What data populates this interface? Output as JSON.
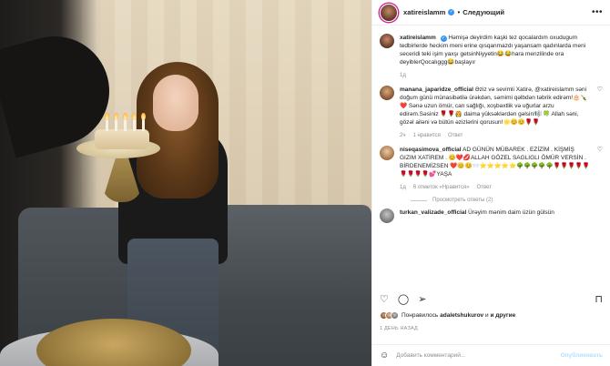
{
  "header": {
    "username": "xatireislamm",
    "separator": "•",
    "follow_label": "Следующий",
    "more_label": "•••"
  },
  "caption": {
    "username": "xatireislamm",
    "text": "Həmişə deyirdim kaşki tez qocalardım oxudugum tedbirlerde heckim meni erine qısqanmazdı yaşansam qadınlarda meni seceridi teki işim yaxşı getsinNiyyetin😂😂hara menzilinde ora deyiblerQocalıggg😂başlayır",
    "time": "1д"
  },
  "comments": [
    {
      "username": "manana_japaridze_official",
      "text": "Əziz və sevimli Xatirə, @xatireislamm səni doğum günü münasibətilə ürəkdən, səmimi qəlbdən təbrik edirəm!🎂🍾❤️ Sənə uzun ömür, can sağlığı, xoşbəxtlik və uğurlar arzu edirəm.Səsiniz 🌹🌹👸 daima yüksəklərdən gəlsin!🎼🍀 Allah səni, gözəl ailəni və bütün əzizlərini qorusun!🌟😊😊🌹🌹",
      "time": "2ч",
      "likes": "1 нравится",
      "reply": "Ответ"
    },
    {
      "username": "niseqasimova_official",
      "text": "AD GÜNÜN MÜBAREK . EZİZİM . KİŞMİŞ GIZIM XATİREM . 😊❤️💋ALLAH GÖZEL SAGLIGLI ÖMÜR VERSİN . BİRDENEMİZSEN ❤️😊😊📨⭐⭐⭐⭐⭐🌳🌳🌳🌳🌳🌹🌹🌹🌹🌹🌹🌹🌹🌹💕YAŞA",
      "time": "1д",
      "likes": "6 отметок «Нравится»",
      "reply": "Ответ",
      "replies_label": "Просмотреть ответы (2)"
    },
    {
      "username": "turkan_valizade_official",
      "text": "Ürəyim mənim daim üzün gülsün",
      "time": "",
      "likes": "",
      "reply": ""
    }
  ],
  "likes_line": {
    "prefix": "Понравилось",
    "user": "adaletshukurov",
    "suffix": "и другие",
    "and": "и"
  },
  "date_label": "1 ДЕНЬ НАЗАД",
  "add_comment": {
    "placeholder": "Добавить комментарий...",
    "post_label": "Опубликовать"
  },
  "icons": {
    "like": "heart-icon",
    "comment": "comment-icon",
    "share": "share-icon",
    "save": "bookmark-icon"
  }
}
